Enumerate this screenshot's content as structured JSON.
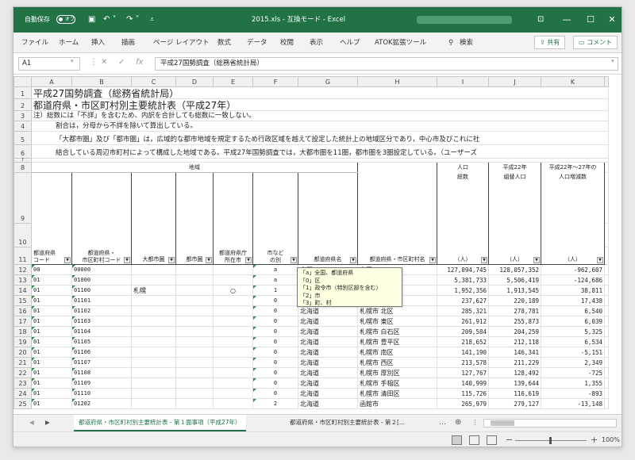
{
  "titlebar": {
    "autosave_label": "自動保存",
    "autosave_state": "オフ",
    "title": "2015.xls  -  互換モード  -  Excel"
  },
  "menu": {
    "items": [
      "ファイル",
      "ホーム",
      "挿入",
      "描画",
      "ページ レイアウト",
      "数式",
      "データ",
      "校閲",
      "表示",
      "ヘルプ",
      "ATOK拡張ツール"
    ],
    "search": "検索",
    "share": "共有",
    "comment": "コメント"
  },
  "formula": {
    "namebox": "A1",
    "content": "平成27国勢調査（総務省統計局）"
  },
  "columns": [
    "A",
    "B",
    "C",
    "D",
    "E",
    "F",
    "G",
    "H",
    "I",
    "J",
    "K"
  ],
  "top_rows": {
    "r1": "平成27国勢調査（総務省統計局）",
    "r2": "都道府県・市区町村別主要統計表（平成27年）",
    "r3": "注）総数には「不詳」を含むため、内訳を合計しても総数に一致しない。",
    "r4": "割合は，分母から不詳を除いて算出している。",
    "r5": "「大都市圏」及び「都市圏」は，広域的な都市地域を規定するため行政区域を越えて設定した統計上の地域区分であり，中心市及びこれに社",
    "r6": "結合している周辺市町村によって構成した地域である。平成27年国勢調査では，大都市圏を11圏，都市圏を3圏設定している。（ユーザーズ"
  },
  "header": {
    "region": "地域",
    "i_top": "人口",
    "i_sub": "総数",
    "j_top": "平成22年",
    "j_sub": "組替人口",
    "k_top": "平成22年～27年の",
    "k_sub": "人口増減数",
    "a11": "都道府県\nコード",
    "b11": "都道府県・\n市区町村コード",
    "c11": "大都市圏",
    "d11": "都市圏",
    "e11": "都道府県庁\n所在市",
    "f11": "市など\nの別",
    "g11": "都道府県名",
    "h11": "都道府県・市区町村名",
    "unit": "（人）"
  },
  "comment": {
    "lines": [
      "「a」全国、都道府県",
      "「0」区",
      "「1」政令市（特別区部を含む）",
      "「2」市",
      "「3」町、村"
    ]
  },
  "rows": [
    {
      "n": "12",
      "a": "00",
      "b": "00000",
      "c": "",
      "e": "",
      "f": "a",
      "g": "全国",
      "h": "全国",
      "i": "127,094,745",
      "j": "128,057,352",
      "k": "-962,607"
    },
    {
      "n": "13",
      "a": "01",
      "b": "01000",
      "c": "",
      "e": "",
      "f": "a",
      "g": "北海道",
      "h": "北海道",
      "i": "5,381,733",
      "j": "5,506,419",
      "k": "-124,686"
    },
    {
      "n": "14",
      "a": "01",
      "b": "01100",
      "c": "札幌",
      "e": "○",
      "f": "1",
      "g": "北海道",
      "h": "札幌市",
      "i": "1,952,356",
      "j": "1,913,545",
      "k": "38,811"
    },
    {
      "n": "15",
      "a": "01",
      "b": "01101",
      "c": "",
      "e": "",
      "f": "0",
      "g": "北海道",
      "h": "札幌市 中央区",
      "i": "237,627",
      "j": "220,189",
      "k": "17,438"
    },
    {
      "n": "16",
      "a": "01",
      "b": "01102",
      "c": "",
      "e": "",
      "f": "0",
      "g": "北海道",
      "h": "札幌市 北区",
      "i": "285,321",
      "j": "278,781",
      "k": "6,540"
    },
    {
      "n": "17",
      "a": "01",
      "b": "01103",
      "c": "",
      "e": "",
      "f": "0",
      "g": "北海道",
      "h": "札幌市 東区",
      "i": "261,912",
      "j": "255,873",
      "k": "6,039"
    },
    {
      "n": "18",
      "a": "01",
      "b": "01104",
      "c": "",
      "e": "",
      "f": "0",
      "g": "北海道",
      "h": "札幌市 白石区",
      "i": "209,584",
      "j": "204,259",
      "k": "5,325"
    },
    {
      "n": "19",
      "a": "01",
      "b": "01105",
      "c": "",
      "e": "",
      "f": "0",
      "g": "北海道",
      "h": "札幌市 豊平区",
      "i": "218,652",
      "j": "212,118",
      "k": "6,534"
    },
    {
      "n": "20",
      "a": "01",
      "b": "01106",
      "c": "",
      "e": "",
      "f": "0",
      "g": "北海道",
      "h": "札幌市 南区",
      "i": "141,190",
      "j": "146,341",
      "k": "-5,151"
    },
    {
      "n": "21",
      "a": "01",
      "b": "01107",
      "c": "",
      "e": "",
      "f": "0",
      "g": "北海道",
      "h": "札幌市 西区",
      "i": "213,578",
      "j": "211,229",
      "k": "2,349"
    },
    {
      "n": "22",
      "a": "01",
      "b": "01108",
      "c": "",
      "e": "",
      "f": "0",
      "g": "北海道",
      "h": "札幌市 厚別区",
      "i": "127,767",
      "j": "128,492",
      "k": "-725"
    },
    {
      "n": "23",
      "a": "01",
      "b": "01109",
      "c": "",
      "e": "",
      "f": "0",
      "g": "北海道",
      "h": "札幌市 手稲区",
      "i": "140,999",
      "j": "139,644",
      "k": "1,355"
    },
    {
      "n": "24",
      "a": "01",
      "b": "01110",
      "c": "",
      "e": "",
      "f": "0",
      "g": "北海道",
      "h": "札幌市 清田区",
      "i": "115,726",
      "j": "116,619",
      "k": "-893"
    },
    {
      "n": "25",
      "a": "01",
      "b": "01202",
      "c": "",
      "e": "",
      "f": "2",
      "g": "北海道",
      "h": "函館市",
      "i": "265,979",
      "j": "279,127",
      "k": "-13,148"
    }
  ],
  "tabs": {
    "active": "都道府県・市区町村別主要統計表 - 第１面事項（平成27年）",
    "second": "都道府県・市区町村別主要統計表 - 第２[..."
  },
  "status": {
    "zoom": "100%"
  }
}
